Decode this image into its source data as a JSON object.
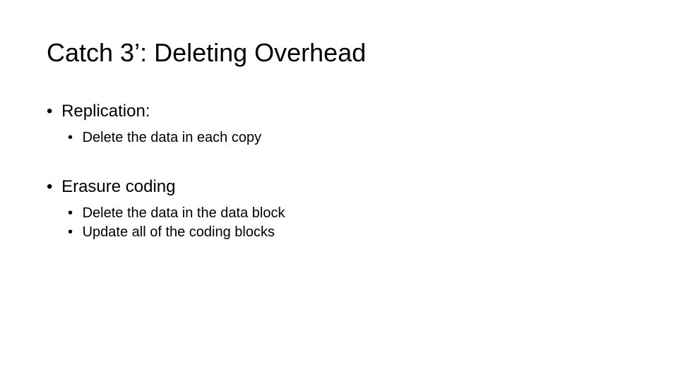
{
  "title": "Catch 3’: Deleting Overhead",
  "bullets": [
    {
      "label": "Replication:",
      "children": [
        "Delete the data in each copy"
      ]
    },
    {
      "label": "Erasure coding",
      "children": [
        "Delete the data in the data block",
        "Update all of the coding blocks"
      ]
    }
  ]
}
